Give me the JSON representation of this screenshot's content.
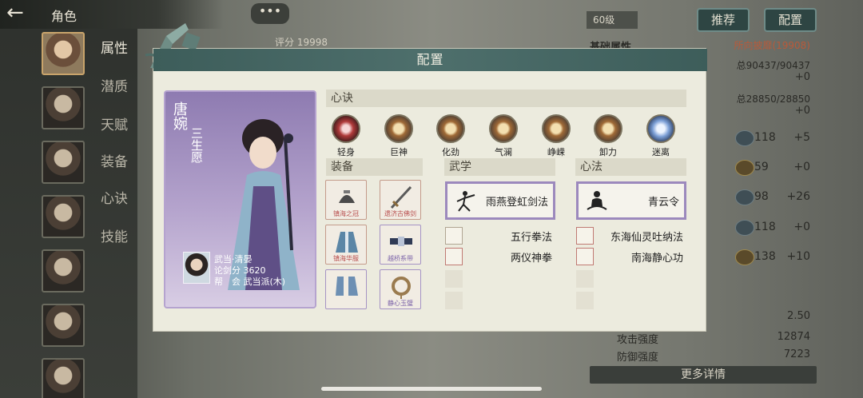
{
  "header": {
    "page_title": "角色",
    "chat_icon": "•••"
  },
  "sidebar": {
    "tabs": [
      {
        "label": "属性",
        "active": true
      },
      {
        "label": "潜质",
        "active": false
      },
      {
        "label": "天赋",
        "active": false
      },
      {
        "label": "装备",
        "active": false
      },
      {
        "label": "心诀",
        "active": false
      },
      {
        "label": "技能",
        "active": false
      }
    ]
  },
  "background": {
    "level": "60级",
    "score": "评分 19998",
    "recommend_button": "推荐",
    "config_button": "配置",
    "base_attr_label": "基础属性",
    "invincible": "所向披靡(19908)",
    "hp": "总90437/90437",
    "hp_delta": "+0",
    "mp": "总28850/28850",
    "mp_delta": "+0",
    "attrs": [
      {
        "value": "118",
        "delta": "+5"
      },
      {
        "value": "59",
        "delta": "+0"
      },
      {
        "value": "98",
        "delta": "+26"
      },
      {
        "value": "118",
        "delta": "+0"
      },
      {
        "value": "138",
        "delta": "+10"
      }
    ],
    "crit_value": "2.50",
    "attack_label": "攻击强度",
    "attack_value": "12874",
    "defense_label": "防御强度",
    "defense_value": "7223",
    "more_details": "更多详情"
  },
  "dialog": {
    "title": "配置",
    "character": {
      "name": "唐婉",
      "title": "三生愿",
      "sect": "武当·清晏",
      "sword_score": "论剑分 3620",
      "guild": "帮　会 武当派(木)"
    },
    "heart_section": "心诀",
    "heart_skills": [
      {
        "label": "轻身",
        "color": "red"
      },
      {
        "label": "巨神",
        "color": "gold"
      },
      {
        "label": "化劲",
        "color": "gold"
      },
      {
        "label": "气澜",
        "color": "gold"
      },
      {
        "label": "峥嵘",
        "color": "gold"
      },
      {
        "label": "卸力",
        "color": "gold"
      },
      {
        "label": "迷离",
        "color": "blue"
      }
    ],
    "equip_section": "装备",
    "equipment": [
      {
        "name": "镇海之冠",
        "color": "red"
      },
      {
        "name": "遗济古佛剑",
        "color": "red"
      },
      {
        "name": "镇海华服",
        "color": "red"
      },
      {
        "name": "越桥系带",
        "color": "purple"
      },
      {
        "name": "",
        "color": "purple"
      },
      {
        "name": "静心玉璧",
        "color": "purple"
      }
    ],
    "martial_section": "武学",
    "martial_main": "雨燕登虹剑法",
    "martial_subs": [
      "五行拳法",
      "两仪神拳"
    ],
    "mind_section": "心法",
    "mind_main": "青云令",
    "mind_subs": [
      "东海仙灵吐纳法",
      "南海静心功"
    ]
  },
  "colors": {
    "dialog_header": "#4e6f6c",
    "dialog_bg": "#ecebde",
    "card_purple": "#b5a4cd",
    "red_quality": "#b84c4c",
    "purple_quality": "#7b62a8"
  }
}
